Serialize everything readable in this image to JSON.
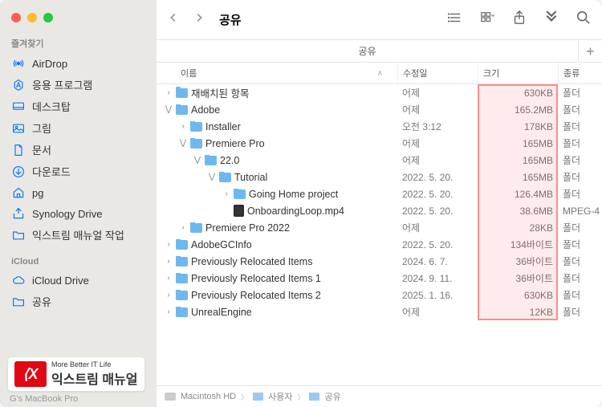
{
  "window": {
    "title": "공유",
    "tab": "공유"
  },
  "sidebar": {
    "favorites_label": "즐겨찾기",
    "icloud_label": "iCloud",
    "favorites": [
      {
        "icon": "airdrop",
        "label": "AirDrop"
      },
      {
        "icon": "apps",
        "label": "응용 프로그램"
      },
      {
        "icon": "desktop",
        "label": "데스크탑"
      },
      {
        "icon": "pictures",
        "label": "그림"
      },
      {
        "icon": "documents",
        "label": "문서"
      },
      {
        "icon": "downloads",
        "label": "다운로드"
      },
      {
        "icon": "home",
        "label": "pg"
      },
      {
        "icon": "synology",
        "label": "Synology Drive"
      },
      {
        "icon": "folder",
        "label": "익스트림 매뉴얼 작업"
      }
    ],
    "icloud": [
      {
        "icon": "cloud",
        "label": "iCloud Drive"
      },
      {
        "icon": "shared",
        "label": "공유"
      }
    ]
  },
  "columns": {
    "name": "이름",
    "date": "수정일",
    "size": "크기",
    "kind": "종류"
  },
  "files": [
    {
      "depth": 0,
      "expand": "closed",
      "type": "folder",
      "name": "재배치된 항목",
      "date": "어제",
      "size": "630KB",
      "kind": "폴더"
    },
    {
      "depth": 0,
      "expand": "open",
      "type": "folder",
      "name": "Adobe",
      "date": "어제",
      "size": "165.2MB",
      "kind": "폴더"
    },
    {
      "depth": 1,
      "expand": "closed",
      "type": "folder",
      "name": "Installer",
      "date": "오전 3:12",
      "size": "178KB",
      "kind": "폴더"
    },
    {
      "depth": 1,
      "expand": "open",
      "type": "folder",
      "name": "Premiere Pro",
      "date": "어제",
      "size": "165MB",
      "kind": "폴더"
    },
    {
      "depth": 2,
      "expand": "open",
      "type": "folder",
      "name": "22.0",
      "date": "어제",
      "size": "165MB",
      "kind": "폴더"
    },
    {
      "depth": 3,
      "expand": "open",
      "type": "folder",
      "name": "Tutorial",
      "date": "2022. 5. 20.",
      "size": "165MB",
      "kind": "폴더"
    },
    {
      "depth": 4,
      "expand": "closed",
      "type": "folder",
      "name": "Going Home project",
      "date": "2022. 5. 20.",
      "size": "126.4MB",
      "kind": "폴더"
    },
    {
      "depth": 4,
      "expand": "none",
      "type": "video",
      "name": "OnboardingLoop.mp4",
      "date": "2022. 5. 20.",
      "size": "38.6MB",
      "kind": "MPEG-4"
    },
    {
      "depth": 1,
      "expand": "closed",
      "type": "folder",
      "name": "Premiere Pro 2022",
      "date": "어제",
      "size": "28KB",
      "kind": "폴더"
    },
    {
      "depth": 0,
      "expand": "closed",
      "type": "folder",
      "name": "AdobeGCInfo",
      "date": "2022. 5. 20.",
      "size": "134바이트",
      "kind": "폴더"
    },
    {
      "depth": 0,
      "expand": "closed",
      "type": "folder",
      "name": "Previously Relocated Items",
      "date": "2024. 6. 7.",
      "size": "36바이트",
      "kind": "폴더"
    },
    {
      "depth": 0,
      "expand": "closed",
      "type": "folder",
      "name": "Previously Relocated Items 1",
      "date": "2024. 9. 11.",
      "size": "36바이트",
      "kind": "폴더"
    },
    {
      "depth": 0,
      "expand": "closed",
      "type": "folder",
      "name": "Previously Relocated Items 2",
      "date": "2025. 1. 16.",
      "size": "630KB",
      "kind": "폴더"
    },
    {
      "depth": 0,
      "expand": "closed",
      "type": "folder",
      "name": "UnrealEngine",
      "date": "어제",
      "size": "12KB",
      "kind": "폴더"
    }
  ],
  "path": {
    "p1": "Macintosh HD",
    "p2": "사용자",
    "p3": "공유"
  },
  "footer": "G's MacBook Pro",
  "watermark": {
    "tagline": "More Better IT Life",
    "brand": "익스트림 매뉴얼"
  }
}
